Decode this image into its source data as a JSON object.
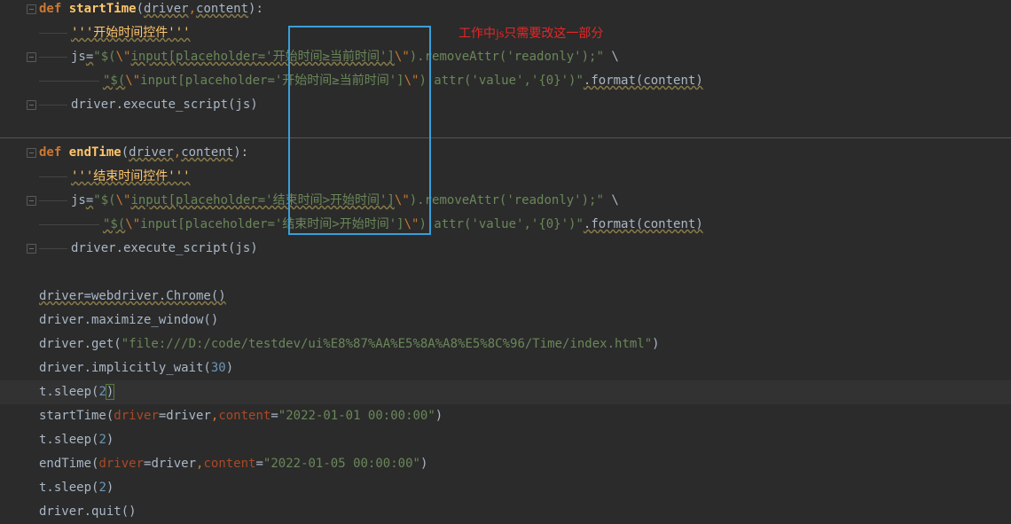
{
  "editor": {
    "lines": [
      {
        "segments": [
          {
            "t": "def ",
            "c": "kw"
          },
          {
            "t": "startTime",
            "c": "fn"
          },
          {
            "t": "(",
            "c": "plain"
          },
          {
            "t": "driver",
            "c": "param"
          },
          {
            "t": ",",
            "c": "comma"
          },
          {
            "t": "content",
            "c": "param"
          },
          {
            "t": "):",
            "c": "plain"
          }
        ]
      },
      {
        "segments": [
          {
            "t": "'''开始时间控件'''",
            "c": "doc"
          }
        ]
      },
      {
        "segments": [
          {
            "t": "js",
            "c": "plain"
          },
          {
            "t": "=",
            "c": "plain"
          },
          {
            "t": "\"$(",
            "c": "str"
          },
          {
            "t": "\\\"",
            "c": "escape"
          },
          {
            "t": "input[placeholder='开始时间≥当前时间']",
            "c": "str"
          },
          {
            "t": "\\\"",
            "c": "escape"
          },
          {
            "t": ").removeAttr('readonly');\"",
            "c": "str"
          },
          {
            "t": " \\",
            "c": "plain"
          }
        ]
      },
      {
        "segments": [
          {
            "t": "\"$(",
            "c": "str"
          },
          {
            "t": "\\\"",
            "c": "escape"
          },
          {
            "t": "input[placeholder='开始时间≥当前时间']",
            "c": "str"
          },
          {
            "t": "\\\"",
            "c": "escape"
          },
          {
            "t": ").attr('value','{0}')\"",
            "c": "str"
          },
          {
            "t": ".format(content)",
            "c": "plain"
          }
        ]
      },
      {
        "segments": [
          {
            "t": "driver.execute_script(js)",
            "c": "plain"
          }
        ]
      },
      {
        "segments": []
      },
      {
        "segments": [
          {
            "t": "def ",
            "c": "kw"
          },
          {
            "t": "endTime",
            "c": "fn"
          },
          {
            "t": "(",
            "c": "plain"
          },
          {
            "t": "driver",
            "c": "param"
          },
          {
            "t": ",",
            "c": "comma"
          },
          {
            "t": "content",
            "c": "param"
          },
          {
            "t": "):",
            "c": "plain"
          }
        ]
      },
      {
        "segments": [
          {
            "t": "'''结束时间控件'''",
            "c": "doc"
          }
        ]
      },
      {
        "segments": [
          {
            "t": "js",
            "c": "plain"
          },
          {
            "t": "=",
            "c": "plain"
          },
          {
            "t": "\"$(",
            "c": "str"
          },
          {
            "t": "\\\"",
            "c": "escape"
          },
          {
            "t": "input[placeholder='结束时间>开始时间']",
            "c": "str"
          },
          {
            "t": "\\\"",
            "c": "escape"
          },
          {
            "t": ").removeAttr('readonly');\"",
            "c": "str"
          },
          {
            "t": " \\",
            "c": "plain"
          }
        ]
      },
      {
        "segments": [
          {
            "t": "\"$(",
            "c": "str"
          },
          {
            "t": "\\\"",
            "c": "escape"
          },
          {
            "t": "input[placeholder='结束时间>开始时间']",
            "c": "str"
          },
          {
            "t": "\\\"",
            "c": "escape"
          },
          {
            "t": ").attr('value','{0}')\"",
            "c": "str"
          },
          {
            "t": ".format(content)",
            "c": "plain"
          }
        ]
      },
      {
        "segments": [
          {
            "t": "driver.execute_script(js)",
            "c": "plain"
          }
        ]
      },
      {
        "segments": []
      },
      {
        "segments": [
          {
            "t": "driver=webdriver.Chrome()",
            "c": "plain"
          }
        ]
      },
      {
        "segments": [
          {
            "t": "driver.maximize_window()",
            "c": "plain"
          }
        ]
      },
      {
        "segments": [
          {
            "t": "driver.get(",
            "c": "plain"
          },
          {
            "t": "\"file:///D:/code/testdev/ui%E8%87%AA%E5%8A%A8%E5%8C%96/Time/index.html\"",
            "c": "str"
          },
          {
            "t": ")",
            "c": "plain"
          }
        ]
      },
      {
        "segments": [
          {
            "t": "driver.implicitly_wait(",
            "c": "plain"
          },
          {
            "t": "30",
            "c": "num"
          },
          {
            "t": ")",
            "c": "plain"
          }
        ]
      },
      {
        "segments": [
          {
            "t": "t.sleep(",
            "c": "plain"
          },
          {
            "t": "2",
            "c": "num"
          },
          {
            "t": ")",
            "c": "plain"
          }
        ]
      },
      {
        "segments": [
          {
            "t": "startTime(",
            "c": "plain"
          },
          {
            "t": "driver",
            "c": "named"
          },
          {
            "t": "=driver",
            "c": "plain"
          },
          {
            "t": ",",
            "c": "comma"
          },
          {
            "t": "content",
            "c": "named"
          },
          {
            "t": "=",
            "c": "plain"
          },
          {
            "t": "\"2022-01-01 00:00:00\"",
            "c": "str"
          },
          {
            "t": ")",
            "c": "plain"
          }
        ]
      },
      {
        "segments": [
          {
            "t": "t.sleep(",
            "c": "plain"
          },
          {
            "t": "2",
            "c": "num"
          },
          {
            "t": ")",
            "c": "plain"
          }
        ]
      },
      {
        "segments": [
          {
            "t": "endTime(",
            "c": "plain"
          },
          {
            "t": "driver",
            "c": "named"
          },
          {
            "t": "=driver",
            "c": "plain"
          },
          {
            "t": ",",
            "c": "comma"
          },
          {
            "t": "content",
            "c": "named"
          },
          {
            "t": "=",
            "c": "plain"
          },
          {
            "t": "\"2022-01-05 00:00:00\"",
            "c": "str"
          },
          {
            "t": ")",
            "c": "plain"
          }
        ]
      },
      {
        "segments": [
          {
            "t": "t.sleep(",
            "c": "plain"
          },
          {
            "t": "2",
            "c": "num"
          },
          {
            "t": ")",
            "c": "plain"
          }
        ]
      },
      {
        "segments": [
          {
            "t": "driver.quit()",
            "c": "plain"
          }
        ]
      }
    ],
    "current_line": 16
  },
  "annotation": {
    "text": "工作中js只需要改这一部分"
  },
  "colors": {
    "background": "#2b2b2b",
    "current_line": "#323232",
    "keyword": "#cc7832",
    "function": "#ffc66d",
    "string": "#6a8759",
    "number": "#6897bb",
    "named_arg": "#aa4926",
    "highlight_box": "#3a9fd8",
    "annotation": "#e52727"
  }
}
